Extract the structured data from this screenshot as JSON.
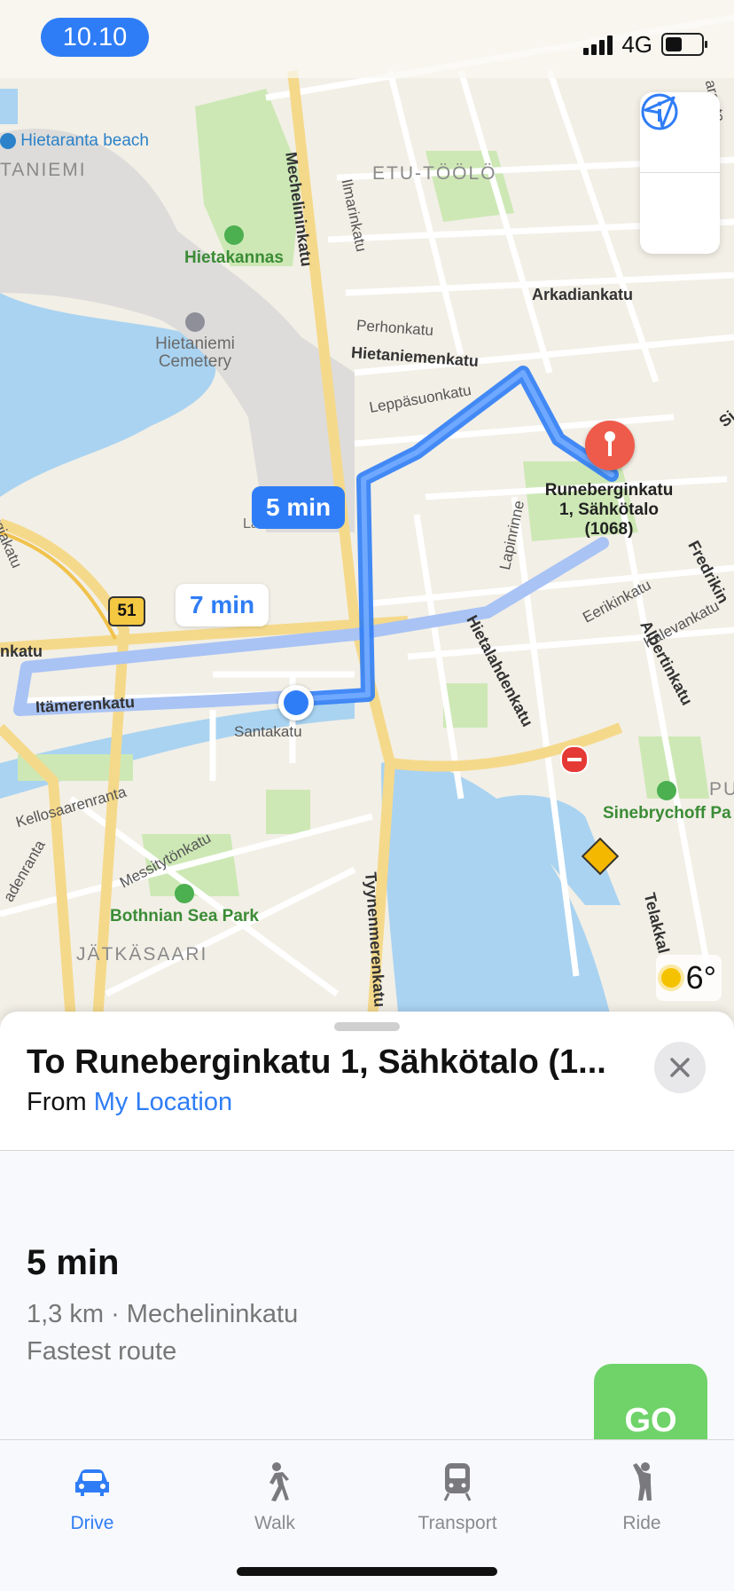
{
  "status_bar": {
    "time": "10.10",
    "network": "4G"
  },
  "map": {
    "districts": [
      "TANIEMI",
      "ETU-TÖÖLÖ",
      "JÄTKÄSAARI",
      "PU"
    ],
    "parks": [
      "Hietakannas",
      "Bothnian Sea Park",
      "Sinebrychoff Pa"
    ],
    "pois": [
      "Hietaranta beach",
      "Hietaniemi Cemetery",
      "La"
    ],
    "streets": {
      "mechelininkatu": "Mechelininkatu",
      "ilmarinkatu": "Ilmarinkatu",
      "arkadiankatu": "Arkadiankatu",
      "perhonkatu": "Perhonkatu",
      "hietaniemenkatu": "Hietaniemenkatu",
      "leppasuonkatu": "Leppäsuonkatu",
      "lapinrinne": "Lapinrinne",
      "eerikinkatu": "Eerikinkatu",
      "kalevankatu": "Kalevankatu",
      "albertinkatu": "Albertinkatu",
      "fredrikinkatu": "Fredrikin",
      "hietalahdenkatu": "Hietalahdenkatu",
      "itamerenkatu": "Itämerenkatu",
      "nkatu": "nkatu",
      "santakatu": "Santakatu",
      "kellosaarenranta": "Kellosaarenranta",
      "messitytonkatu": "Messitytönkatu",
      "tyynenmerenkatu": "Tyynenmerenkatu",
      "denranta": "adenranta",
      "rgiakatu": "rgiakatu",
      "telakkakatu": "Telakkal",
      "arantakatu": "aranta",
      "si": "Si"
    },
    "road_shield": "51",
    "route_callouts": {
      "primary": "5 min",
      "alternate": "7 min"
    },
    "destination_label": [
      "Runeberginkatu",
      "1, Sähkötalo",
      "(1068)"
    ],
    "weather_temp": "6°",
    "colors": {
      "route": "#2f7df6",
      "route_alt": "#a9c3f5",
      "water": "#a9d3f1",
      "park": "#cde8b5",
      "pin": "#ef5b4b"
    }
  },
  "sheet": {
    "title": "To Runeberginkatu 1, Sähkötalo (1...",
    "from_prefix": "From",
    "from_link": "My Location",
    "route": {
      "time": "5 min",
      "detail": "1,3 km · Mechelininkatu",
      "note": "Fastest route"
    },
    "go_label": "GO"
  },
  "tabs": [
    {
      "label": "Drive",
      "icon": "car-icon",
      "active": true
    },
    {
      "label": "Walk",
      "icon": "walk-icon",
      "active": false
    },
    {
      "label": "Transport",
      "icon": "train-icon",
      "active": false
    },
    {
      "label": "Ride",
      "icon": "ride-icon",
      "active": false
    }
  ]
}
